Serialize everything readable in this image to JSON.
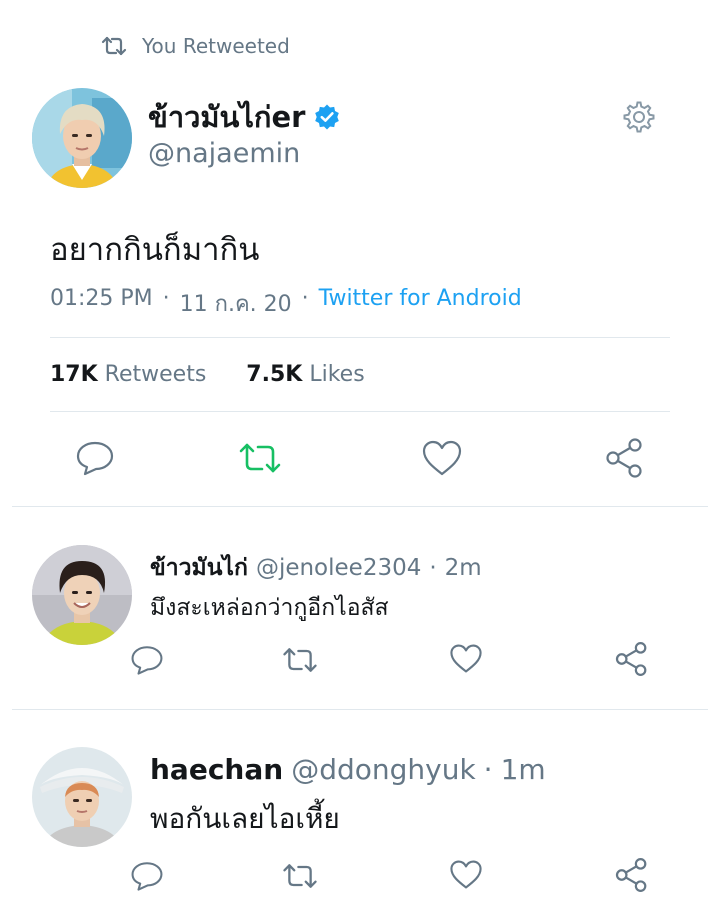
{
  "retweet_context": {
    "label": "You Retweeted"
  },
  "main_tweet": {
    "display_name": "ข้าวมันไก่er",
    "handle": "@najaemin",
    "text": "อยากกินก็มากิน",
    "time": "01:25 PM",
    "date": "11 ก.ค. 20",
    "source": "Twitter for Android",
    "retweets_count": "17K",
    "retweets_label": "Retweets",
    "likes_count": "7.5K",
    "likes_label": "Likes",
    "sep": "·"
  },
  "replies": [
    {
      "display_name": "ข้าวมันไก่",
      "handle": "@jenolee2304",
      "time": "2m",
      "text": "มึงสะเหล่อกว่ากูอีกไอสัส"
    },
    {
      "display_name": "haechan",
      "handle": "@ddonghyuk",
      "time": "1m",
      "text": "พอกันเลยไอเหี้ย"
    }
  ],
  "colors": {
    "accent": "#1da1f2",
    "retweeted": "#17bf63",
    "icon_gray": "#657786",
    "divider": "#e1e8ed"
  },
  "icons": [
    "retweet-icon",
    "verified-badge-icon",
    "gear-icon",
    "reply-icon",
    "like-icon",
    "share-icon"
  ]
}
